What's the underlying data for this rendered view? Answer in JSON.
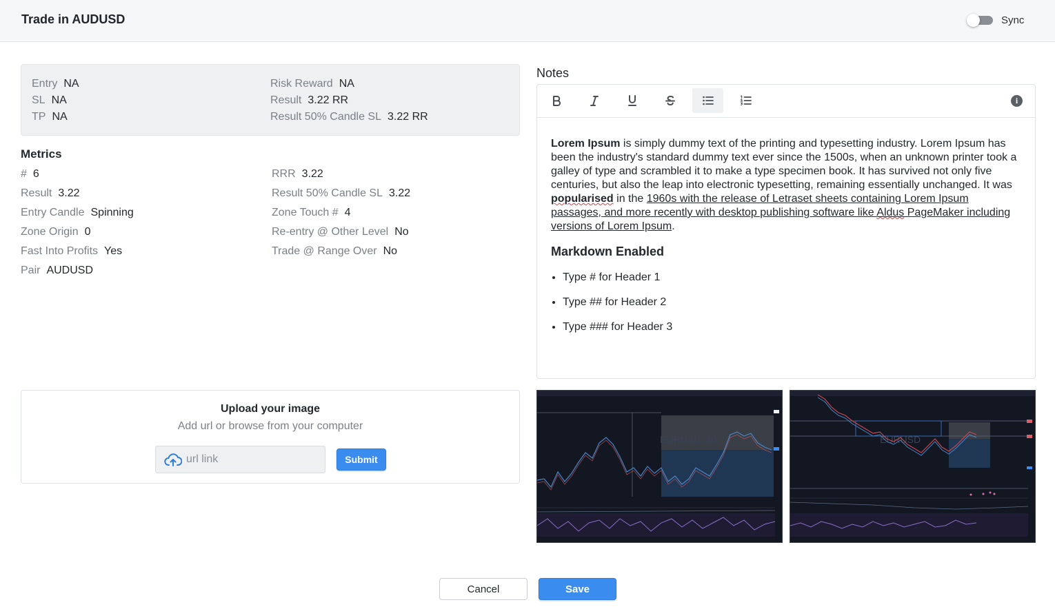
{
  "header": {
    "title": "Trade in AUDUSD",
    "sync_label": "Sync",
    "sync_on": false
  },
  "summary": {
    "left": [
      {
        "key": "Entry",
        "value": "NA"
      },
      {
        "key": "SL",
        "value": "NA"
      },
      {
        "key": "TP",
        "value": "NA"
      }
    ],
    "right": [
      {
        "key": "Risk Reward",
        "value": "NA"
      },
      {
        "key": "Result",
        "value": "3.22 RR"
      },
      {
        "key": "Result 50% Candle SL",
        "value": "3.22 RR"
      }
    ]
  },
  "metrics": {
    "title": "Metrics",
    "left": [
      {
        "key": "#",
        "value": "6"
      },
      {
        "key": "Result",
        "value": "3.22"
      },
      {
        "key": "Entry Candle",
        "value": "Spinning"
      },
      {
        "key": "Zone Origin",
        "value": "0"
      },
      {
        "key": "Fast Into Profits",
        "value": "Yes"
      },
      {
        "key": "Pair",
        "value": "AUDUSD"
      }
    ],
    "right": [
      {
        "key": "RRR",
        "value": "3.22"
      },
      {
        "key": "Result 50% Candle SL",
        "value": "3.22"
      },
      {
        "key": "Zone Touch #",
        "value": "4"
      },
      {
        "key": "Re-entry @ Other Level",
        "value": "No"
      },
      {
        "key": "Trade @ Range Over",
        "value": "No"
      }
    ]
  },
  "upload": {
    "title": "Upload your image",
    "subtitle": "Add url or browse from your computer",
    "placeholder": "url link",
    "submit_label": "Submit",
    "icon": "cloud-upload-icon"
  },
  "notes": {
    "label": "Notes",
    "toolbar": [
      "bold-icon",
      "italic-icon",
      "underline-icon",
      "strikethrough-icon",
      "bullet-list-icon",
      "numbered-list-icon",
      "info-icon"
    ],
    "active_tool": "bullet-list-icon",
    "para": {
      "bold_lead": "Lorem Ipsum",
      "text1": " is simply dummy text of the printing and typesetting industry. Lorem Ipsum has been the industry's standard dummy text ever since the 1500s, when an unknown printer took a galley of type and scrambled it to make a type specimen book. It has survived not only five centuries, but also the leap into electronic typesetting, remaining essentially unchanged. It was ",
      "bold_mid": "popularised",
      "text2": " in the ",
      "link_a": "1960s with the release of Letraset sheets containing Lorem Ipsum passages, and more recently with desktop publishing software like ",
      "link_spell": "Aldus",
      "link_b": " PageMaker including versions of Lorem Ipsum",
      "text3": "."
    },
    "heading": "Markdown Enabled",
    "list": [
      "Type # for Header 1",
      "Type ## for Header 2",
      "Type ### for Header 3"
    ]
  },
  "screenshots": [
    {
      "watermark": "EURUSD, 30"
    },
    {
      "watermark": "EURUSD"
    }
  ],
  "footer": {
    "cancel_label": "Cancel",
    "save_label": "Save"
  },
  "colors": {
    "accent": "#3b8cef",
    "header_bg": "#f6f7f8",
    "panel_bg": "#eff0f1",
    "chart_bg": "#131722"
  }
}
